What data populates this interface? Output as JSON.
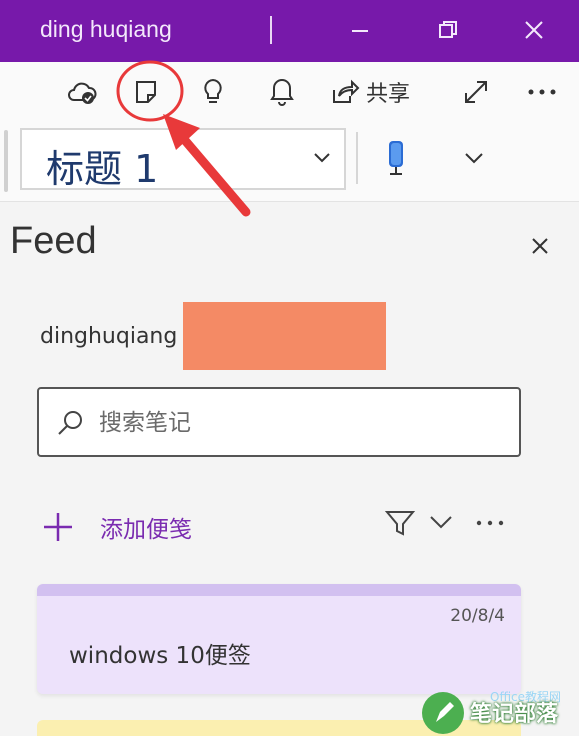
{
  "titlebar": {
    "user_name": "ding huqiang"
  },
  "toolbar": {
    "share_label": "共享",
    "icons": [
      "cloud-sync-icon",
      "sticky-notes-icon",
      "lightbulb-icon",
      "bell-icon",
      "share-icon",
      "expand-icon",
      "more-icon"
    ]
  },
  "style_picker": {
    "selected": "标题 1"
  },
  "feed": {
    "title": "Feed",
    "account_name": "dinghuqiang",
    "search_placeholder": "搜索笔记",
    "add_note_label": "添加便笺",
    "notes": [
      {
        "date": "20/8/4",
        "text": "windows 10便签"
      }
    ]
  },
  "watermark": {
    "title": "笔记部落",
    "domain_text": "Office教程网"
  },
  "colors": {
    "titlebar": "#7719aa",
    "accent": "#7a2bb0",
    "annotation": "#e8393a",
    "note_purple": "#ede2fb",
    "note_yellow": "#fbefb0"
  }
}
